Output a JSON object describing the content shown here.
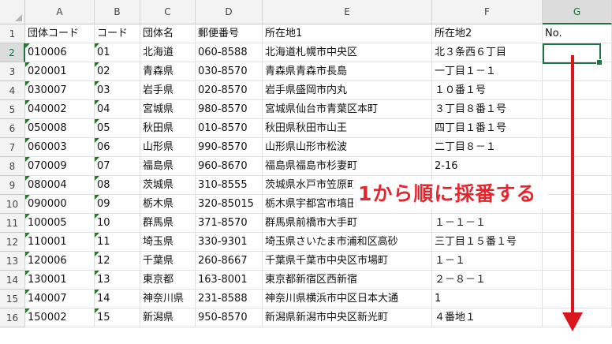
{
  "columns": [
    "A",
    "B",
    "C",
    "D",
    "E",
    "F",
    "G"
  ],
  "selected_column": "G",
  "selected_row": 2,
  "header_row": [
    "団体コード",
    "コード",
    "団体名",
    "郵便番号",
    "所在地1",
    "所在地2",
    "No."
  ],
  "rows": [
    {
      "num": "2",
      "cells": [
        "010006",
        "01",
        "北海道",
        "060-8588",
        "北海道札幌市中央区",
        "北３条西６丁目",
        ""
      ]
    },
    {
      "num": "3",
      "cells": [
        "020001",
        "02",
        "青森県",
        "030-8570",
        "青森県青森市長島",
        "一丁目１－１",
        ""
      ]
    },
    {
      "num": "4",
      "cells": [
        "030007",
        "03",
        "岩手県",
        "020-8570",
        "岩手県盛岡市内丸",
        "１０番１号",
        ""
      ]
    },
    {
      "num": "5",
      "cells": [
        "040002",
        "04",
        "宮城県",
        "980-8570",
        "宮城県仙台市青葉区本町",
        "３丁目８番１号",
        ""
      ]
    },
    {
      "num": "6",
      "cells": [
        "050008",
        "05",
        "秋田県",
        "010-8570",
        "秋田県秋田市山王",
        "四丁目１番１号",
        ""
      ]
    },
    {
      "num": "7",
      "cells": [
        "060003",
        "06",
        "山形県",
        "990-8570",
        "山形県山形市松波",
        "二丁目８－１",
        ""
      ]
    },
    {
      "num": "8",
      "cells": [
        "070009",
        "07",
        "福島県",
        "960-8670",
        "福島県福島市杉妻町",
        "2-16",
        ""
      ]
    },
    {
      "num": "9",
      "cells": [
        "080004",
        "08",
        "茨城県",
        "310-8555",
        "茨城県水戸市笠原町",
        "",
        ""
      ]
    },
    {
      "num": "10",
      "cells": [
        "090000",
        "09",
        "栃木県",
        "320-85015",
        "栃木県宇都宮市塙田",
        "",
        ""
      ]
    },
    {
      "num": "11",
      "cells": [
        "100005",
        "10",
        "群馬県",
        "371-8570",
        "群馬県前橋市大手町",
        "１－１－１",
        ""
      ]
    },
    {
      "num": "12",
      "cells": [
        "110001",
        "11",
        "埼玉県",
        "330-9301",
        "埼玉県さいたま市浦和区高砂",
        "三丁目１５番１号",
        ""
      ]
    },
    {
      "num": "13",
      "cells": [
        "120006",
        "12",
        "千葉県",
        "260-8667",
        "千葉県千葉市中央区市場町",
        "１－１",
        ""
      ]
    },
    {
      "num": "14",
      "cells": [
        "130001",
        "13",
        "東京都",
        "163-8001",
        "東京都新宿区西新宿",
        "２－８－１",
        ""
      ]
    },
    {
      "num": "15",
      "cells": [
        "140007",
        "14",
        "神奈川県",
        "231-8588",
        "神奈川県横浜市中区日本大通",
        "1",
        ""
      ]
    },
    {
      "num": "16",
      "cells": [
        "150002",
        "15",
        "新潟県",
        "950-8570",
        "新潟県新潟市中央区新光町",
        "４番地１",
        ""
      ]
    }
  ],
  "header_row_num": "1",
  "annotation": {
    "text": "1から順に採番する",
    "color": "#e8242c"
  },
  "colors": {
    "accent": "#217346",
    "triangle": "#1e7a2e",
    "arrow": "#d9151e"
  }
}
